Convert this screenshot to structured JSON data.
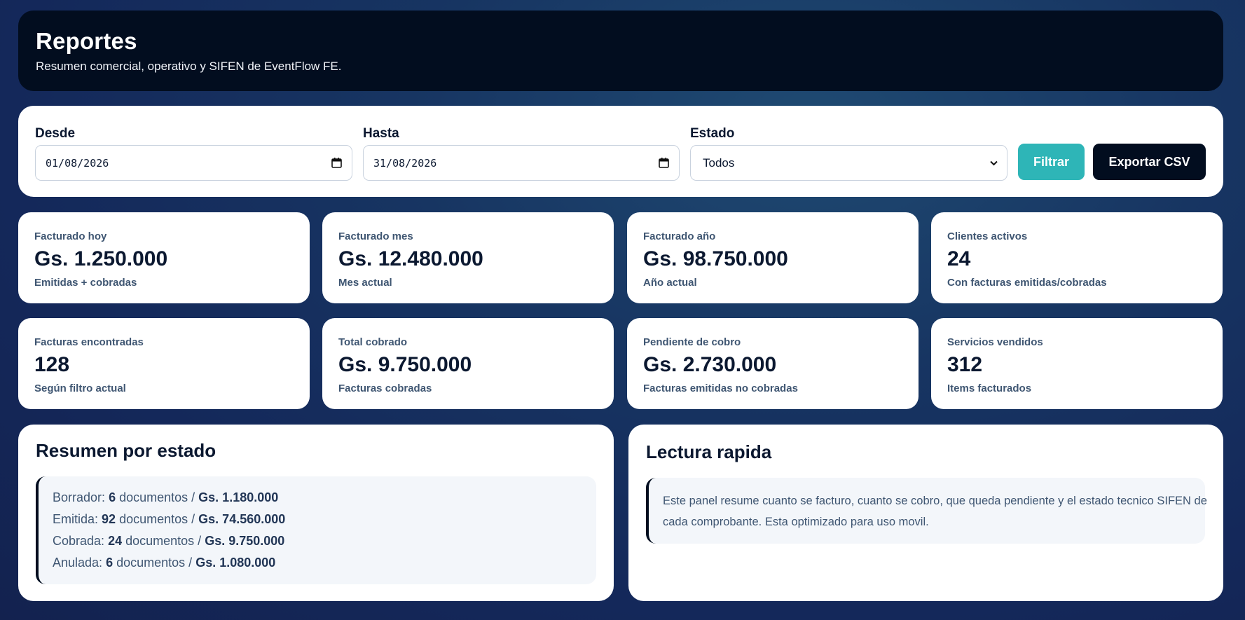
{
  "header": {
    "title": "Reportes",
    "subtitle": "Resumen comercial, operativo y SIFEN de EventFlow FE."
  },
  "filters": {
    "desde_label": "Desde",
    "desde_value": "01/08/2026",
    "hasta_label": "Hasta",
    "hasta_value": "31/08/2026",
    "estado_label": "Estado",
    "estado_value": "Todos",
    "filter_button": "Filtrar",
    "export_button": "Exportar CSV"
  },
  "kpis": [
    {
      "label": "Facturado hoy",
      "value": "Gs. 1.250.000",
      "sub": "Emitidas + cobradas"
    },
    {
      "label": "Facturado mes",
      "value": "Gs. 12.480.000",
      "sub": "Mes actual"
    },
    {
      "label": "Facturado año",
      "value": "Gs. 98.750.000",
      "sub": "Año actual"
    },
    {
      "label": "Clientes activos",
      "value": "24",
      "sub": "Con facturas emitidas/cobradas"
    },
    {
      "label": "Facturas encontradas",
      "value": "128",
      "sub": "Según filtro actual"
    },
    {
      "label": "Total cobrado",
      "value": "Gs. 9.750.000",
      "sub": "Facturas cobradas"
    },
    {
      "label": "Pendiente de cobro",
      "value": "Gs. 2.730.000",
      "sub": "Facturas emitidas no cobradas"
    },
    {
      "label": "Servicios vendidos",
      "value": "312",
      "sub": "Items facturados"
    }
  ],
  "summary": {
    "title": "Resumen por estado",
    "rows": [
      {
        "estado": "Borrador:",
        "count": "6",
        "docs": "documentos /",
        "amount": "Gs. 1.180.000"
      },
      {
        "estado": "Emitida:",
        "count": "92",
        "docs": "documentos /",
        "amount": "Gs. 74.560.000"
      },
      {
        "estado": "Cobrada:",
        "count": "24",
        "docs": "documentos /",
        "amount": "Gs. 9.750.000"
      },
      {
        "estado": "Anulada:",
        "count": "6",
        "docs": "documentos /",
        "amount": "Gs. 1.080.000"
      }
    ]
  },
  "quick": {
    "title": "Lectura rapida",
    "text": "Este panel resume cuanto se facturo, cuanto se cobro, que queda pendiente y el estado tecnico SIFEN de cada comprobante. Esta optimizado para uso movil."
  }
}
